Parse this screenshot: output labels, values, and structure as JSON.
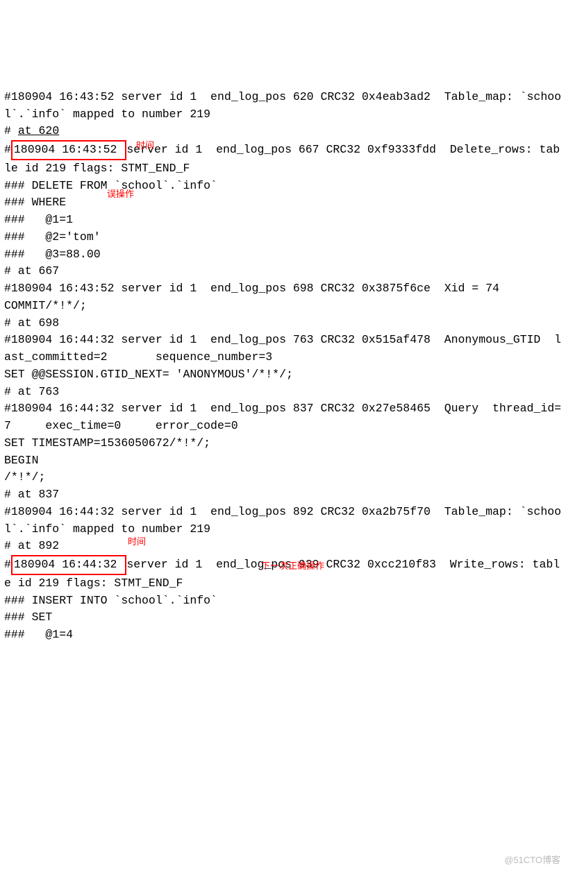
{
  "lines": {
    "l01": "#180904 16:43:52 server id 1  end_log_pos 620 CRC32 0x4eab3ad2  Table_map: `school`.`info` mapped to number 219",
    "l02a": "# ",
    "l02b": "at 620",
    "l03a": "#",
    "l03b": "180904 16:43:52 ",
    "l03c": "server id 1  end_log_pos 667 CRC32 0xf9333fdd  Delete_rows: table id 219 flags: STMT_END_F",
    "l04": "### DELETE FROM `school`.`info`",
    "l05": "### WHERE",
    "l06": "###   @1=1",
    "l07": "###   @2='tom'",
    "l08": "###   @3=88.00",
    "l09": "# at 667",
    "l10": "#180904 16:43:52 server id 1  end_log_pos 698 CRC32 0x3875f6ce  Xid = 74",
    "l11": "COMMIT/*!*/;",
    "l12": "# at 698",
    "l13": "#180904 16:44:32 server id 1  end_log_pos 763 CRC32 0x515af478  Anonymous_GTID  last_committed=2       sequence_number=3",
    "l14": "SET @@SESSION.GTID_NEXT= 'ANONYMOUS'/*!*/;",
    "l15": "# at 763",
    "l16": "#180904 16:44:32 server id 1  end_log_pos 837 CRC32 0x27e58465  Query  thread_id=7     exec_time=0     error_code=0",
    "l17": "SET TIMESTAMP=1536050672/*!*/;",
    "l18": "BEGIN",
    "l19": "/*!*/;",
    "l20": "# at 837",
    "l21": "#180904 16:44:32 server id 1  end_log_pos 892 CRC32 0xa2b75f70  Table_map: `school`.`info` mapped to number 219",
    "l22": "# at 892",
    "l23a": "#",
    "l23b": "180904 16:44:32 ",
    "l23c": "server id 1  end_log_pos 939 CRC32 0xcc210f83  Write_rows: table id 219 flags: STMT_END_F",
    "l24": "### INSERT INTO `school`.`info`",
    "l25": "### SET",
    "l26": "###   @1=4"
  },
  "annotations": {
    "time1": "时间",
    "err": "误操作",
    "time2": "时间",
    "next": "下一次正确操作"
  },
  "watermark": "@51CTO博客"
}
